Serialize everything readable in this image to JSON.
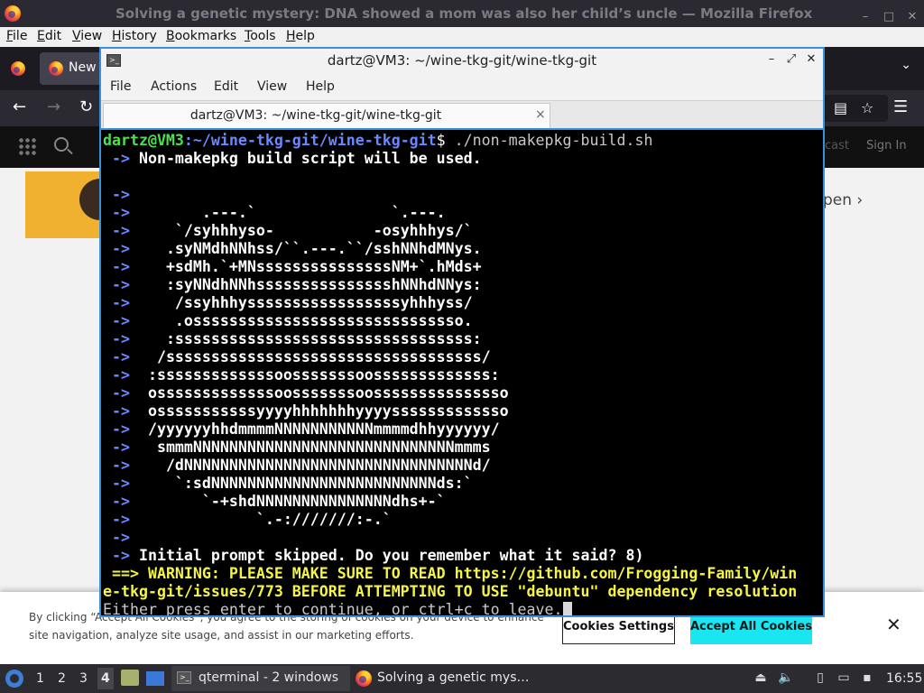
{
  "firefox": {
    "window_title": "Solving a genetic mystery: DNA showed a mom was also her child’s uncle — Mozilla Firefox",
    "menu": [
      "File",
      "Edit",
      "View",
      "History",
      "Bookmarks",
      "Tools",
      "Help"
    ],
    "tab_label": "New",
    "window_controls": [
      "–",
      "□",
      "✕"
    ],
    "nav_icons": [
      "arrow-left-icon",
      "arrow-right-icon",
      "reload-icon",
      "reader-icon",
      "star-icon",
      "hamburger-menu-icon"
    ]
  },
  "website": {
    "header_podcast": "cast",
    "header_signin": "Sign In",
    "open_link": "pen ›",
    "cookie": {
      "text": "By clicking “Accept All Cookies”, you agree to the storing of cookies on your device to enhance site navigation, analyze site usage, and assist in our marketing efforts.",
      "settings_label": "Cookies Settings",
      "accept_label": "Accept All Cookies",
      "close_label": "✕"
    }
  },
  "terminal": {
    "window_title": "dartz@VM3: ~/wine-tkg-git/wine-tkg-git",
    "tab_title": "dartz@VM3: ~/wine-tkg-git/wine-tkg-git",
    "tab_close": "×",
    "menu": [
      "File",
      "Actions",
      "Edit",
      "View",
      "Help"
    ],
    "prompt_user": "dartz@VM3",
    "prompt_path": ":~/wine-tkg-git/wine-tkg-git",
    "prompt_symbol": "$",
    "command": " ./non-makepkg-build.sh",
    "arrow": " ->",
    "warn_arrow": " ==>",
    "line_non_makepkg": " Non-makepkg build script will be used.",
    "ascii_art": [
      "",
      "        .---.`               `.---.",
      "     `/syhhhyso-           -osyhhhys/`",
      "    .syNMdhNNhss/``.---.``/sshNNhdMNys.",
      "    +sdMh.`+MNsssssssssssssssNM+`.hMds+",
      "    :syNNdhNNhssssssssssssssshNNhdNNys:",
      "     /ssyhhhysssssssssssssssssyhhhyss/",
      "     .ossssssssssssssssssssssssssssso.",
      "    :sssssssssssssssssssssssssssssssss:",
      "   /sssssssssssssssssssssssssssssssssss/",
      "  :sssssssssssssoosssssssoosssssssssssss:",
      "  osssssssssssssoosssssssoosssssssssssssso",
      "  osssssssssssyyyyhhhhhhhyyyysssssssssssso",
      "  /yyyyyyhhdmmmmNNNNNNNNNNNmmmmdhhyyyyyy/",
      "   smmmNNNNNNNNNNNNNNNNNNNNNNNNNNNNNmmms",
      "    /dNNNNNNNNNNNNNNNNNNNNNNNNNNNNNNNNd/",
      "     `:sdNNNNNNNNNNNNNNNNNNNNNNNNNds:`",
      "        `-+shdNNNNNNNNNNNNNNNdhs+-`",
      "              `.-:///////:-.`",
      ""
    ],
    "line_initial_prompt": " Initial prompt skipped. Do you remember what it said? 8)",
    "line_warning_1": " WARNING: PLEASE MAKE SURE TO READ https://github.com/Frogging-Family/win",
    "line_warning_2": "e-tkg-git/issues/773 BEFORE ATTEMPTING TO USE \"debuntu\" dependency resolution",
    "line_continue": "Either press enter to continue, or ctrl+c to leave."
  },
  "taskbar": {
    "workspaces": [
      "1",
      "2",
      "3",
      "4"
    ],
    "active_workspace": "4",
    "qterminal_label": "qterminal - 2 windows",
    "firefox_label": "Solving a genetic mys…",
    "clock": "16:55",
    "tray_icons": [
      "eject-icon",
      "volume-icon",
      "clipboard-icon",
      "network-icon",
      "notification-icon"
    ]
  }
}
